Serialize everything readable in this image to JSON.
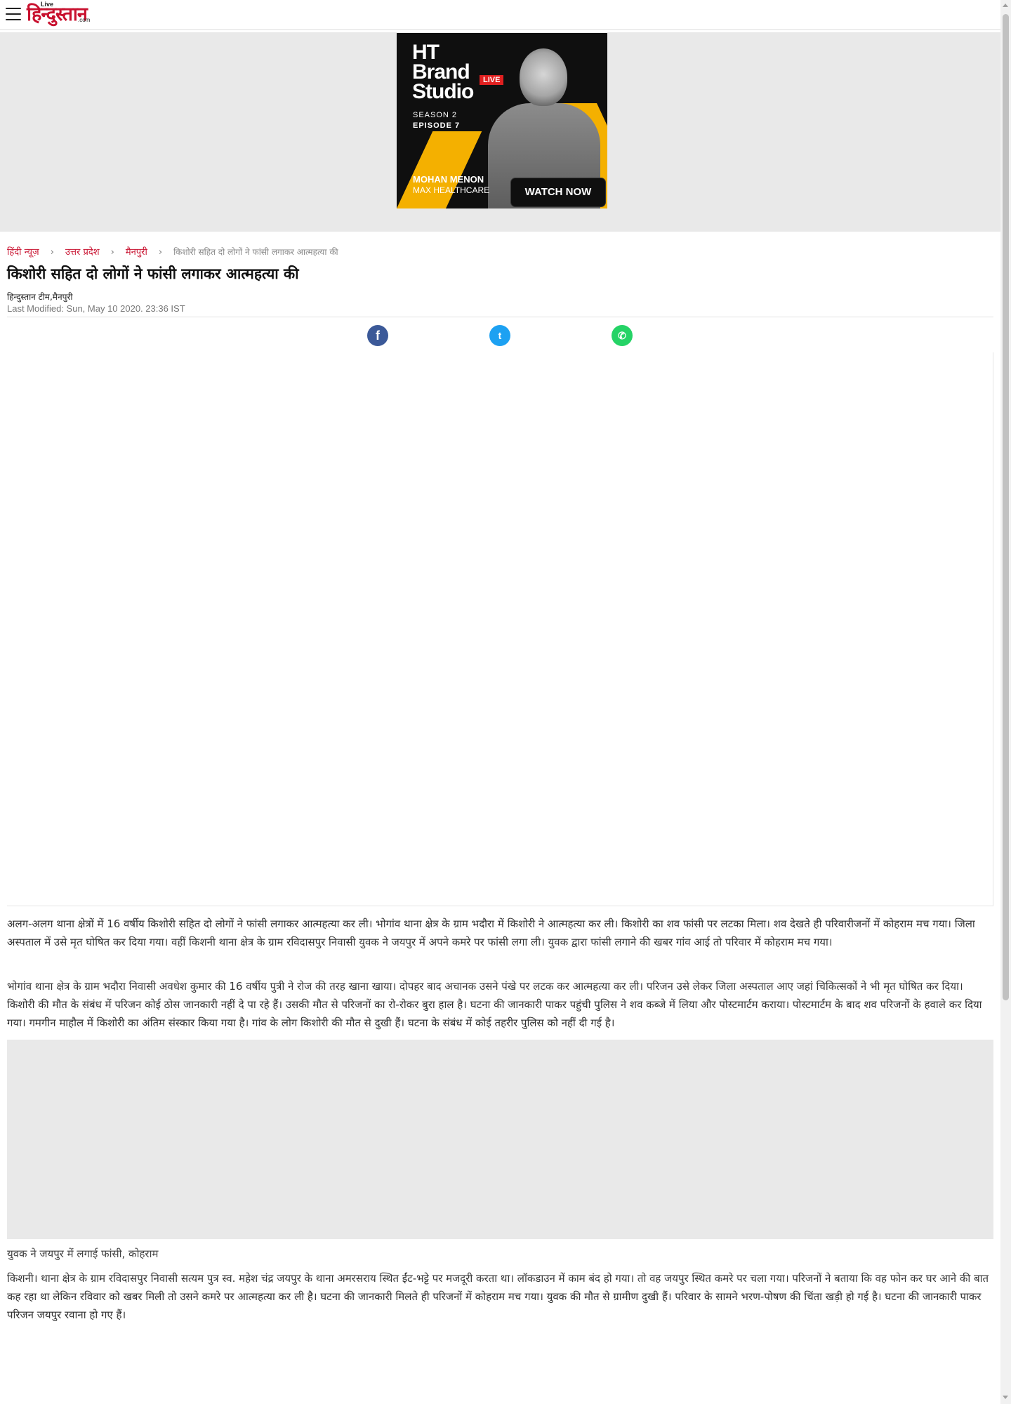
{
  "header": {
    "logo_live": "Live",
    "logo_text": "हिन्दुस्तान",
    "logo_com": ".com"
  },
  "ad": {
    "line1": "HT",
    "line2": "Brand",
    "line3": "Studio",
    "badge": "LIVE",
    "season": "SEASON 2",
    "episode": "EPISODE 7",
    "name": "MOHAN MENON",
    "org": "MAX HEALTHCARE",
    "cta": "WATCH NOW"
  },
  "breadcrumb": {
    "items": [
      "हिंदी न्यूज़",
      "उत्तर प्रदेश",
      "मैनपुरी"
    ],
    "separator": "›",
    "current": "किशोरी सहित दो लोगों ने फांसी लगाकर आत्महत्या की"
  },
  "article": {
    "title": "किशोरी सहित दो लोगों ने फांसी लगाकर आत्महत्या की",
    "author": "हिन्दुस्तान टीम,मैनपुरी",
    "modified": "Last Modified: Sun, May 10 2020. 23:36 IST",
    "p1": "अलग-अलग थाना क्षेत्रों में 16 वर्षीय किशोरी सहित दो लोगों ने फांसी लगाकर आत्महत्या कर ली। भोगांव थाना क्षेत्र के ग्राम भदौरा में किशोरी ने आत्महत्या कर ली। किशोरी का शव फांसी पर लटका मिला। शव देखते ही परिवारीजनों में कोहराम मच गया। जिला अस्पताल में उसे मृत घोषित कर दिया गया। वहीं किशनी थाना क्षेत्र के ग्राम रविदासपुर निवासी युवक ने जयपुर में अपने कमरे पर फांसी लगा ली। युवक द्वारा फांसी लगाने की खबर गांव आई तो परिवार में कोहराम मच गया।",
    "p2": "भोगांव थाना क्षेत्र के ग्राम भदौरा निवासी अवधेश कुमार की 16 वर्षीय पुत्री ने रोज की तरह खाना खाया। दोपहर बाद अचानक उसने पंखे पर लटक कर आत्महत्या कर ली। परिजन उसे लेकर जिला अस्पताल आए जहां चिकित्सकों ने भी मृत घोषित कर दिया। किशोरी की मौत के संबंध में परिजन कोई ठोस जानकारी नहीं दे पा रहे हैं। उसकी मौत से परिजनों का रो-रोकर बुरा हाल है। घटना की जानकारी पाकर पहुंची पुलिस ने शव कब्जे में लिया और पोस्टमार्टम कराया। पोस्टमार्टम के बाद शव परिजनों के हवाले कर दिया गया। गमगीन माहौल में किशोरी का अंतिम संस्कार किया गया है। गांव के लोग किशोरी की मौत से दुखी हैं। घटना के संबंध में कोई तहरीर पुलिस को नहीं दी गई है।",
    "subhead": "युवक ने जयपुर में लगाई फांसी, कोहराम",
    "p3": "किशनी। थाना क्षेत्र के ग्राम रविदासपुर निवासी सत्यम पुत्र स्व. महेश चंद्र जयपुर के थाना अमरसराय स्थित ईंट-भट्टे पर मजदूरी करता था। लॉकडाउन में काम बंद हो गया। तो वह जयपुर स्थित कमरे पर चला गया। परिजनों ने बताया कि वह फोन कर घर आने की बात कह रहा था लेकिन रविवार को खबर मिली तो उसने कमरे पर आत्महत्या कर ली है। घटना की जानकारी मिलते ही परिजनों में कोहराम मच गया। युवक की मौत से ग्रामीण दुखी हैं। परिवार के सामने भरण-पोषण की चिंता खड़ी हो गई है। घटना की जानकारी पाकर परिजन जयपुर रवाना हो गए हैं।"
  },
  "share": {
    "facebook_glyph": "f",
    "twitter_glyph": "t",
    "whatsapp_glyph": "✆"
  },
  "colors": {
    "brand_red": "#c8102e",
    "facebook": "#3b5998",
    "twitter": "#1da1f2",
    "whatsapp": "#25d366"
  }
}
